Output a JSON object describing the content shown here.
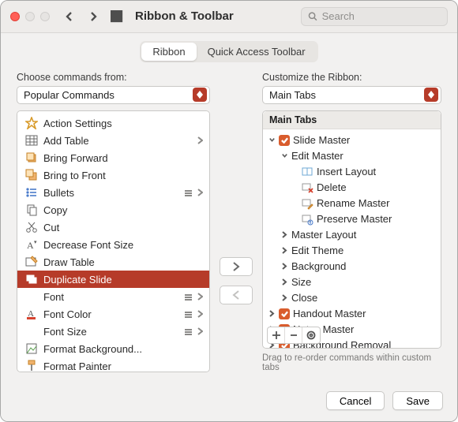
{
  "window": {
    "title": "Ribbon & Toolbar"
  },
  "search": {
    "placeholder": "Search"
  },
  "tabs": {
    "ribbon": "Ribbon",
    "qat": "Quick Access Toolbar"
  },
  "left": {
    "label": "Choose commands from:",
    "dropdown": "Popular Commands",
    "commands": {
      "c0": "Action Settings",
      "c1": "Add Table",
      "c2": "Bring Forward",
      "c3": "Bring to Front",
      "c4": "Bullets",
      "c5": "Copy",
      "c6": "Cut",
      "c7": "Decrease Font Size",
      "c8": "Draw Table",
      "c9": "Duplicate Slide",
      "c10": "Font",
      "c11": "Font Color",
      "c12": "Font Size",
      "c13": "Format Background...",
      "c14": "Format Painter"
    }
  },
  "right": {
    "label": "Customize the Ribbon:",
    "dropdown": "Main Tabs",
    "header": "Main Tabs",
    "nodes": {
      "n0": "Slide Master",
      "n1": "Edit Master",
      "n2": "Insert Layout",
      "n3": "Delete",
      "n4": "Rename Master",
      "n5": "Preserve Master",
      "n6": "Master Layout",
      "n7": "Edit Theme",
      "n8": "Background",
      "n9": "Size",
      "n10": "Close",
      "n11": "Handout Master",
      "n12": "Notes Master",
      "n13": "Background Removal"
    },
    "hint": "Drag to re-order commands within custom tabs"
  },
  "footer": {
    "cancel": "Cancel",
    "save": "Save"
  }
}
